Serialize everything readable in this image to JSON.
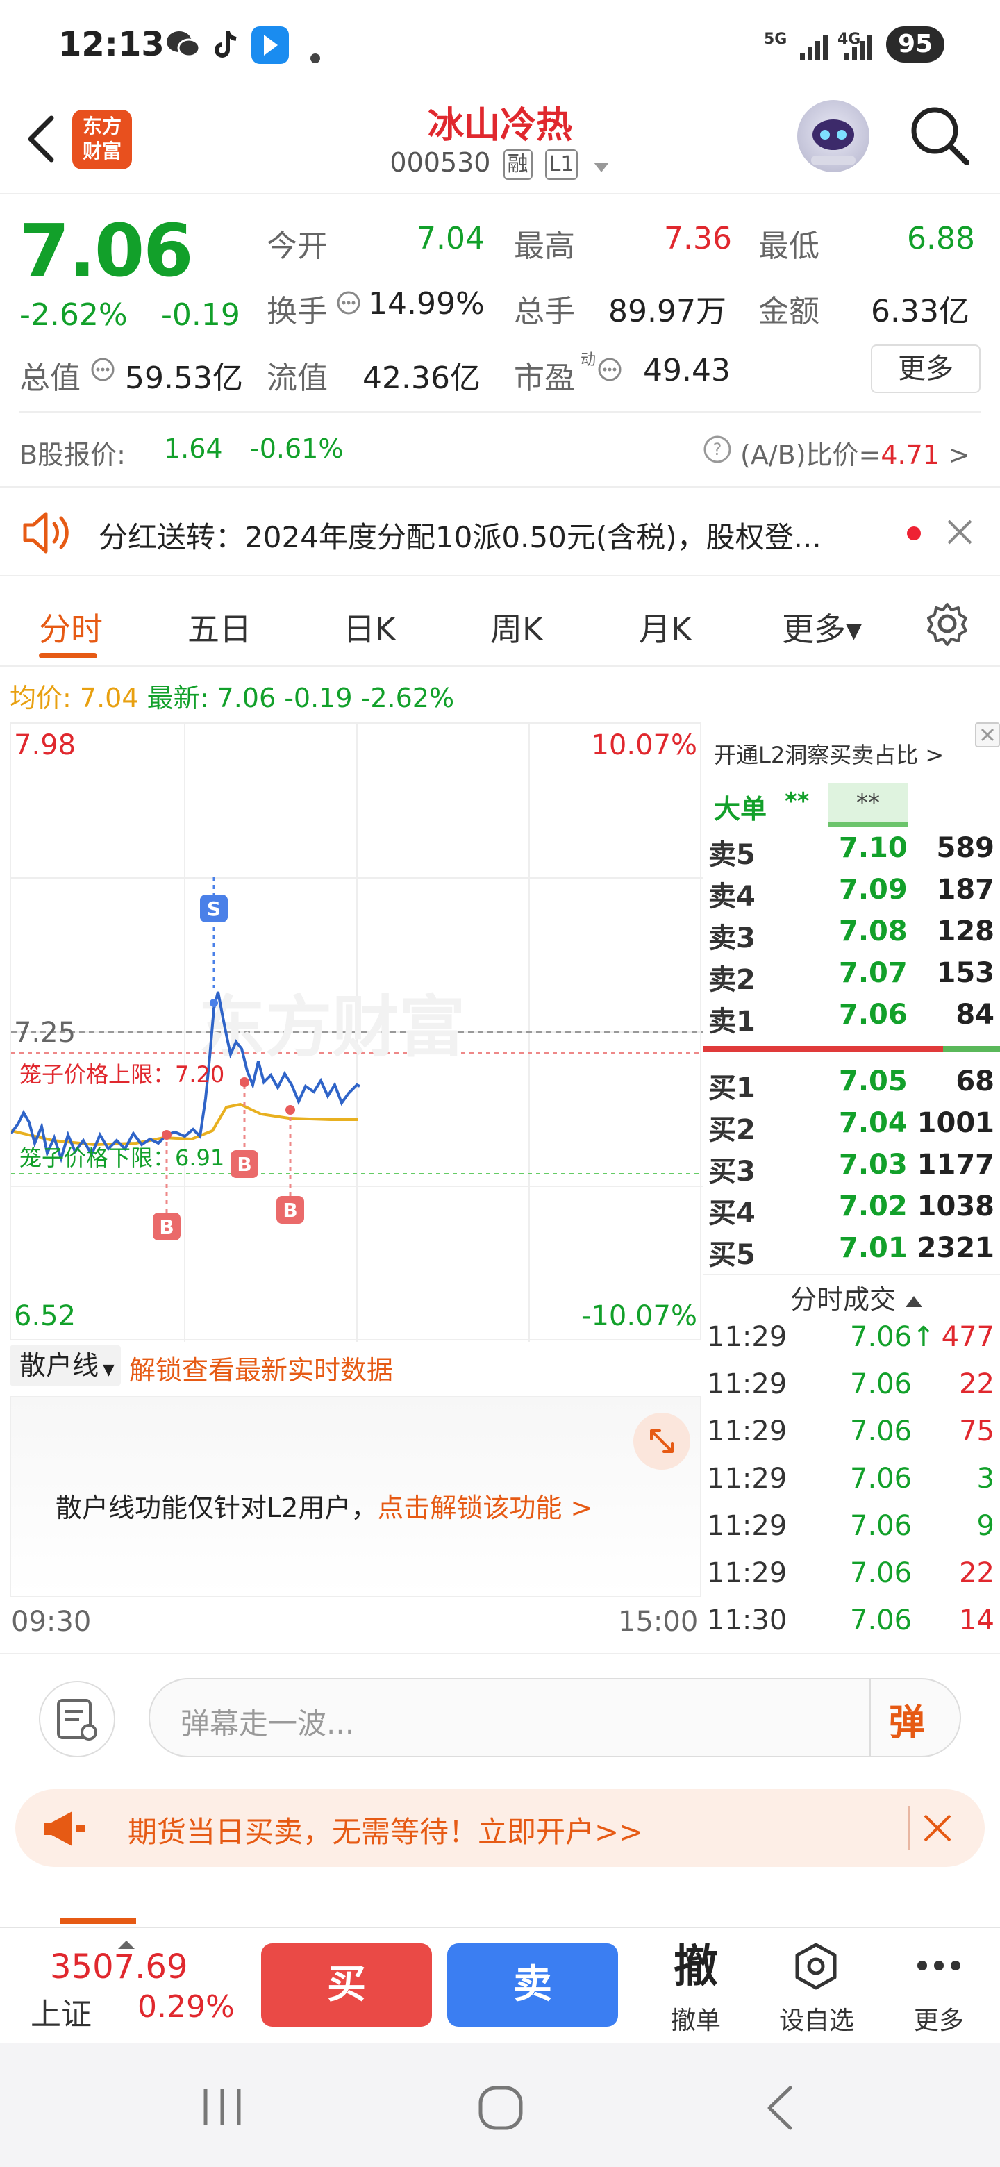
{
  "status_bar": {
    "time": "12:13",
    "network_5g": "5G",
    "network_4g": "4G",
    "battery": "95",
    "icons": [
      "wechat-icon",
      "tiktok-icon",
      "app-icon",
      "dot-icon",
      "signal-icon",
      "signal-icon"
    ]
  },
  "header": {
    "logo_line1": "东方",
    "logo_line2": "财富",
    "stock_name": "冰山冷热",
    "stock_code": "000530",
    "badge_rong": "融",
    "badge_level": "L1"
  },
  "quote": {
    "price": "7.06",
    "change_pct": "-2.62%",
    "change_amt": "-0.19",
    "open_label": "今开",
    "open_value": "7.04",
    "high_label": "最高",
    "high_value": "7.36",
    "low_label": "最低",
    "low_value": "6.88",
    "turnover_label": "换手",
    "turnover_value": "14.99%",
    "volume_label": "总手",
    "volume_value": "89.97万",
    "amount_label": "金额",
    "amount_value": "6.33亿",
    "mcap_label": "总值",
    "mcap_value": "59.53亿",
    "float_label": "流值",
    "float_value": "42.36亿",
    "pe_label": "市盈",
    "pe_sup": "动",
    "pe_value": "49.43",
    "more_button": "更多",
    "bshare_label": "B股报价:",
    "bshare_price": "1.64",
    "bshare_change": "-0.61%",
    "ab_ratio_label": "(A/B)比价=",
    "ab_ratio_value": "4.71",
    "ab_ratio_arrow": ">"
  },
  "announcement": {
    "text": "分红送转：2024年度分配10派0.50元(含税)，股权登..."
  },
  "tabs": [
    {
      "label": "分时"
    },
    {
      "label": "五日"
    },
    {
      "label": "日K"
    },
    {
      "label": "周K"
    },
    {
      "label": "月K"
    },
    {
      "label": "更多▾"
    }
  ],
  "avg_line": {
    "avg_label": "均价:",
    "avg_value": "7.04",
    "latest_label": "最新:",
    "latest_value": "7.06",
    "latest_change": "-0.19",
    "latest_pct": "-2.62%"
  },
  "chart": {
    "y_top": "7.98",
    "y_bottom": "6.52",
    "pct_top": "10.07%",
    "pct_bottom": "-10.07%",
    "ref_line": "7.25",
    "upper_cage": "笼子价格上限：7.20",
    "lower_cage": "笼子价格下限：6.91",
    "watermark": "东方财富",
    "marker_s": "S",
    "marker_b": "B",
    "time_start": "09:30",
    "time_end": "15:00"
  },
  "sanhu": {
    "select": "散户线",
    "unlock_link": "解锁查看最新实时数据",
    "notice": "散户线功能仅针对L2用户，",
    "notice_link": "点击解锁该功能 >"
  },
  "orderbook": {
    "title": "开通L2洞察买卖占比",
    "title_arrow": ">",
    "big_order_label": "大单",
    "big_order_a": "**",
    "big_order_b": "**",
    "asks": [
      {
        "label": "卖5",
        "price": "7.10",
        "vol": "589"
      },
      {
        "label": "卖4",
        "price": "7.09",
        "vol": "187"
      },
      {
        "label": "卖3",
        "price": "7.08",
        "vol": "128"
      },
      {
        "label": "卖2",
        "price": "7.07",
        "vol": "153"
      },
      {
        "label": "卖1",
        "price": "7.06",
        "vol": "84"
      }
    ],
    "bids": [
      {
        "label": "买1",
        "price": "7.05",
        "vol": "68"
      },
      {
        "label": "买2",
        "price": "7.04",
        "vol": "1001"
      },
      {
        "label": "买3",
        "price": "7.03",
        "vol": "1177"
      },
      {
        "label": "买4",
        "price": "7.02",
        "vol": "1038"
      },
      {
        "label": "买5",
        "price": "7.01",
        "vol": "2321"
      }
    ],
    "trades_title": "分时成交",
    "trades": [
      {
        "time": "11:29",
        "price": "7.06↑",
        "vol": "477",
        "color": "#e0282e"
      },
      {
        "time": "11:29",
        "price": "7.06",
        "vol": "22",
        "color": "#e0282e"
      },
      {
        "time": "11:29",
        "price": "7.06",
        "vol": "75",
        "color": "#e0282e"
      },
      {
        "time": "11:29",
        "price": "7.06",
        "vol": "3",
        "color": "#12a02a"
      },
      {
        "time": "11:29",
        "price": "7.06",
        "vol": "9",
        "color": "#12a02a"
      },
      {
        "time": "11:29",
        "price": "7.06",
        "vol": "22",
        "color": "#e0282e"
      },
      {
        "time": "11:30",
        "price": "7.06",
        "vol": "14",
        "color": "#e0282e"
      }
    ]
  },
  "danmu": {
    "placeholder": "弹幕走一波...",
    "send_label": "弹"
  },
  "futures": {
    "text": "期货当日买卖，无需等待！立即开户>>"
  },
  "bottombar": {
    "index_value": "3507.69",
    "index_name": "上证",
    "index_pct": "0.29%",
    "buy": "买",
    "sell": "卖",
    "cancel_glyph": "撤",
    "cancel_label": "撤单",
    "watch_label": "设自选",
    "more_label": "更多"
  },
  "colors": {
    "up": "#e0282e",
    "down": "#12a02a",
    "accent": "#e65a14",
    "buy_btn": "#ea4a46",
    "sell_btn": "#3b7ef2",
    "avg_line": "#e8b020",
    "price_line": "#2f64c8"
  }
}
